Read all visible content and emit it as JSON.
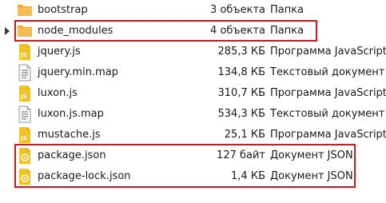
{
  "files": [
    {
      "name": "bootstrap",
      "size": "3 объекта",
      "type": "Папка",
      "icon": "folder-icon"
    },
    {
      "name": "node_modules",
      "size": "4 объекта",
      "type": "Папка",
      "icon": "folder-icon"
    },
    {
      "name": "jquery.js",
      "size": "285,3 КБ",
      "type": "Программа JavaScript",
      "icon": "javascript-file-icon"
    },
    {
      "name": "jquery.min.map",
      "size": "134,8 КБ",
      "type": "Текстовый документ",
      "icon": "text-file-icon"
    },
    {
      "name": "luxon.js",
      "size": "310,7 КБ",
      "type": "Программа JavaScript",
      "icon": "javascript-file-icon"
    },
    {
      "name": "luxon.js.map",
      "size": "534,3 КБ",
      "type": "Текстовый документ",
      "icon": "text-file-icon"
    },
    {
      "name": "mustache.js",
      "size": "25,1 КБ",
      "type": "Программа JavaScript",
      "icon": "javascript-file-icon"
    },
    {
      "name": "package.json",
      "size": "127 байт",
      "type": "Документ JSON",
      "icon": "json-file-icon"
    },
    {
      "name": "package-lock.json",
      "size": "1,4 КБ",
      "type": "Документ JSON",
      "icon": "json-file-icon"
    }
  ],
  "colors": {
    "highlight": "#d9141b",
    "folder": "#f0b44c",
    "javascript": "#f4c21f"
  }
}
